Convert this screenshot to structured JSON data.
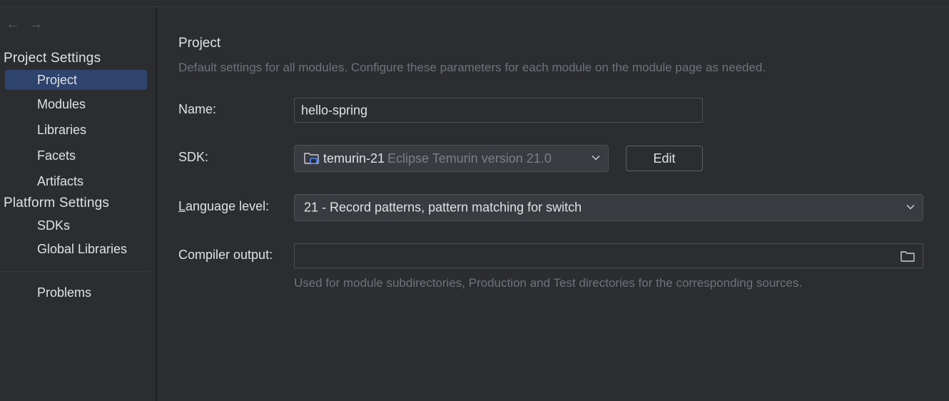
{
  "nav": {
    "back_icon": "arrow-left-icon",
    "forward_icon": "arrow-right-icon"
  },
  "sidebar": {
    "groups": [
      {
        "title": "Project Settings",
        "items": [
          {
            "label": "Project",
            "selected": true
          },
          {
            "label": "Modules"
          },
          {
            "label": "Libraries"
          },
          {
            "label": "Facets"
          },
          {
            "label": "Artifacts"
          }
        ]
      },
      {
        "title": "Platform Settings",
        "items": [
          {
            "label": "SDKs"
          },
          {
            "label": "Global Libraries"
          }
        ]
      }
    ],
    "problems": "Problems"
  },
  "main": {
    "title": "Project",
    "description": "Default settings for all modules. Configure these parameters for each module on the module page as needed.",
    "name": {
      "label": "Name:",
      "value": "hello-spring"
    },
    "sdk": {
      "label": "SDK:",
      "name": "temurin-21",
      "detail": "Eclipse Temurin version 21.0",
      "icon": "jdk-folder-icon",
      "edit_label": "Edit"
    },
    "language_level": {
      "label_mnemonic": "L",
      "label_rest": "anguage level:",
      "value": "21 - Record patterns, pattern matching for switch"
    },
    "compiler_output": {
      "label": "Compiler output:",
      "value": "",
      "hint": "Used for module subdirectories, Production and Test directories for the corresponding sources."
    }
  },
  "colors": {
    "background": "#2b2d30",
    "selection": "#2e436e",
    "text": "#dfe1e5",
    "muted": "#6f737a",
    "sdk_icon_accent": "#548af7"
  }
}
